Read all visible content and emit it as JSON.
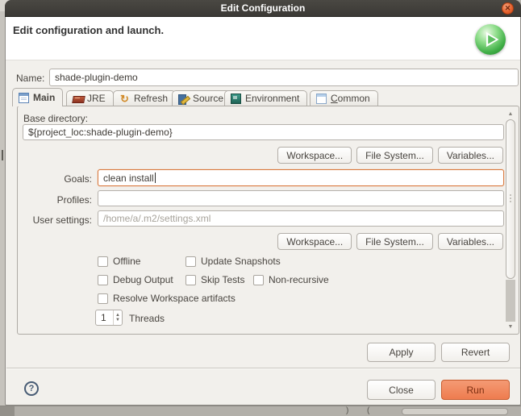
{
  "window": {
    "title": "Edit Configuration",
    "close_glyph": "✕"
  },
  "header": {
    "message": "Edit configuration and launch."
  },
  "name_field": {
    "label": "Name:",
    "value": "shade-plugin-demo"
  },
  "tabs": [
    {
      "label": "Main",
      "selected": true
    },
    {
      "label": "JRE",
      "selected": false
    },
    {
      "label": "Refresh",
      "selected": false
    },
    {
      "label": "Source",
      "selected": false
    },
    {
      "label": "Environment",
      "selected": false
    },
    {
      "label": "Common",
      "mnemonic": "C",
      "rest": "ommon",
      "selected": false
    }
  ],
  "main_tab": {
    "base_directory": {
      "label": "Base directory:",
      "value": "${project_loc:shade-plugin-demo}"
    },
    "browse_buttons": [
      "Workspace...",
      "File System...",
      "Variables..."
    ],
    "goals": {
      "label": "Goals:",
      "value": "clean install"
    },
    "profiles": {
      "label": "Profiles:",
      "value": ""
    },
    "user_settings": {
      "label": "User settings:",
      "value": "/home/a/.m2/settings.xml"
    },
    "checkboxes": [
      "Offline",
      "Update Snapshots",
      "Debug Output",
      "Skip Tests",
      "Non-recursive",
      "Resolve Workspace artifacts"
    ],
    "threads": {
      "value": "1",
      "label": "Threads"
    }
  },
  "actions": {
    "apply": "Apply",
    "revert": "Revert"
  },
  "footer": {
    "help_glyph": "?",
    "close": "Close",
    "run": "Run"
  },
  "icons": {
    "refresh_glyph": "↻",
    "scroll_up": "▲",
    "scroll_down": "▼",
    "spin_up": "▲",
    "spin_down": "▼"
  },
  "colors": {
    "titlebar": "#3b3935",
    "focus_accent": "#d97a3f",
    "run_button": "#ee7c4f",
    "play_green": "#3fae46",
    "close_button": "#e7632f",
    "help_icon": "#475b74"
  }
}
